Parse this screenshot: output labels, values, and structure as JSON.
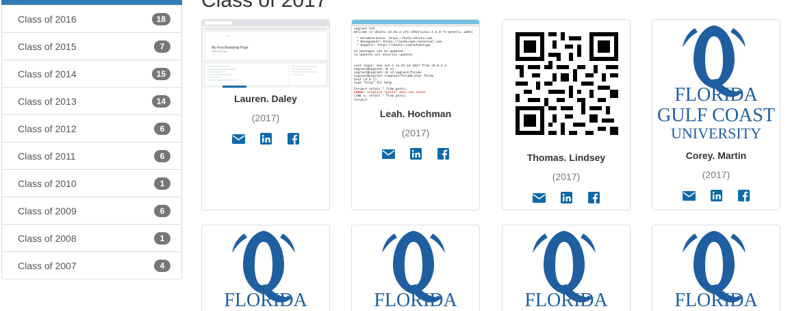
{
  "sidebar": {
    "items": [
      {
        "label": "Class of 2016",
        "count": "18"
      },
      {
        "label": "Class of 2015",
        "count": "7"
      },
      {
        "label": "Class of 2014",
        "count": "15"
      },
      {
        "label": "Class of 2013",
        "count": "14"
      },
      {
        "label": "Class of 2012",
        "count": "6"
      },
      {
        "label": "Class of 2011",
        "count": "6"
      },
      {
        "label": "Class of 2010",
        "count": "1"
      },
      {
        "label": "Class of 2009",
        "count": "6"
      },
      {
        "label": "Class of 2008",
        "count": "1"
      },
      {
        "label": "Class of 2007",
        "count": "4"
      }
    ]
  },
  "main": {
    "heading": "Class of 2017",
    "cards": [
      {
        "name": "Lauren. Daley",
        "year": "(2017)",
        "image": "screenshot-bootstrap-page"
      },
      {
        "name": "Leah. Hochman",
        "year": "(2017)",
        "image": "screenshot-terminal"
      },
      {
        "name": "Thomas. Lindsey",
        "year": "(2017)",
        "image": "qr-code"
      },
      {
        "name": "Corey. Martin",
        "year": "(2017)",
        "image": "fgcu-logo"
      },
      {
        "image": "fgcu-logo"
      },
      {
        "image": "fgcu-logo"
      },
      {
        "image": "fgcu-logo"
      },
      {
        "image": "fgcu-logo"
      }
    ],
    "thumb_text": {
      "bootstrap_title": "My First Bootstrap Page",
      "bootstrap_sub": "This is some text.",
      "terminal_lines": [
        "vagrant ssh",
        "Welcome to Ubuntu 16.04.2 LTS (GNU/Linux 4.4.0-71-generic i686)",
        "* Documentation:  https://help.ubuntu.com",
        "* Management:     https://landscape.canonical.com",
        "* Support:        https://ubuntu.com/advantage",
        "21 packages can be updated.",
        "11 updates are security updates.",
        "Last login: Sun Jun  4 14:17:16 2017 from 10.0.2.2",
        "vagrant@vagrant:~$ cd ..",
        "vagrant@vagrant:/$ cd vagrant/forum/",
        "vagrant@vagrant:/vagrant/forum$ psql forum",
        "psql (9.5.7)",
        "Type \"help\" for help.",
        "forum=# select * from posts;",
        "ERROR:  relation \"posts\" does not exist",
        "LINE 1: select * from posts;",
        "forum=#"
      ]
    },
    "logo_text": {
      "line1": "FLORIDA",
      "line2": "GULF COAST",
      "line3": "UNIVERSITY"
    }
  },
  "colors": {
    "accent": "#337ab7",
    "icon": "#0e6aa8",
    "badge": "#777777",
    "fgcu_blue": "#1f5fa0"
  }
}
